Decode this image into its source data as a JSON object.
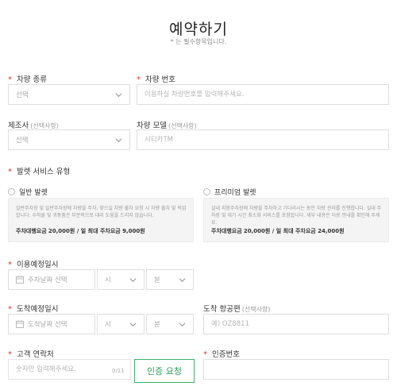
{
  "header": {
    "title": "예약하기",
    "subtitle": "* 는 필수항목입니다."
  },
  "vehicle_type": {
    "label": "차량 종류",
    "value": "선택"
  },
  "vehicle_number": {
    "label": "차량 번호",
    "placeholder": "이용하실 차량번호를 입력해주세요."
  },
  "maker": {
    "label": "제조사",
    "optional": "(선택사항)",
    "value": "선택"
  },
  "model": {
    "label": "차량 모델",
    "optional": "(선택사항)",
    "placeholder": "시티카TM"
  },
  "service": {
    "label": "발렛 서비스 유형",
    "options": [
      {
        "name": "일반 발렛",
        "description": "일반주차장 및 일반주차장에 차량을 주차, 찾으실 차량 출차 요청 시 차량 출차 및 픽업합니다. 수하물 및 귀중품은 부분적으로 대리 도움을 드리지 않습니다.",
        "fee_label": "주차대행요금",
        "fee": "20,000원 / 일 최대 주차요금 9,000원"
      },
      {
        "name": "프리미엄 발렛",
        "description": "실내 지붕주차장에 차량을 주차하고 기다리시는 동안 차량 관리를 진행합니다. 실내 주차장 및 대기 시간 최소화 서비스를 포함합니다. 세부 내용은 이용 안내를 확인해 주세요.",
        "fee_label": "주차대행요금",
        "fee": "20,000원 / 일 최대 주차요금 24,000원"
      }
    ]
  },
  "entry_datetime": {
    "label": "이용예정일시",
    "date_placeholder": "주차날짜 선택",
    "hour": "시",
    "minute": "분"
  },
  "exit_datetime": {
    "label": "도착예정일시",
    "date_placeholder": "도착날짜 선택",
    "hour": "시",
    "minute": "분"
  },
  "flight_number": {
    "label": "도착 항공편",
    "optional": "(선택사항)",
    "placeholder": "예) OZ8811"
  },
  "phone": {
    "label": "고객 연락처",
    "placeholder": "숫자만 입력해주세요.",
    "counter": "0/11"
  },
  "verify_button": {
    "label": "인증 요청"
  },
  "verification": {
    "label": "인증번호",
    "placeholder": ""
  },
  "colors": {
    "accent": "#3bb36a",
    "required": "#e0312a"
  }
}
